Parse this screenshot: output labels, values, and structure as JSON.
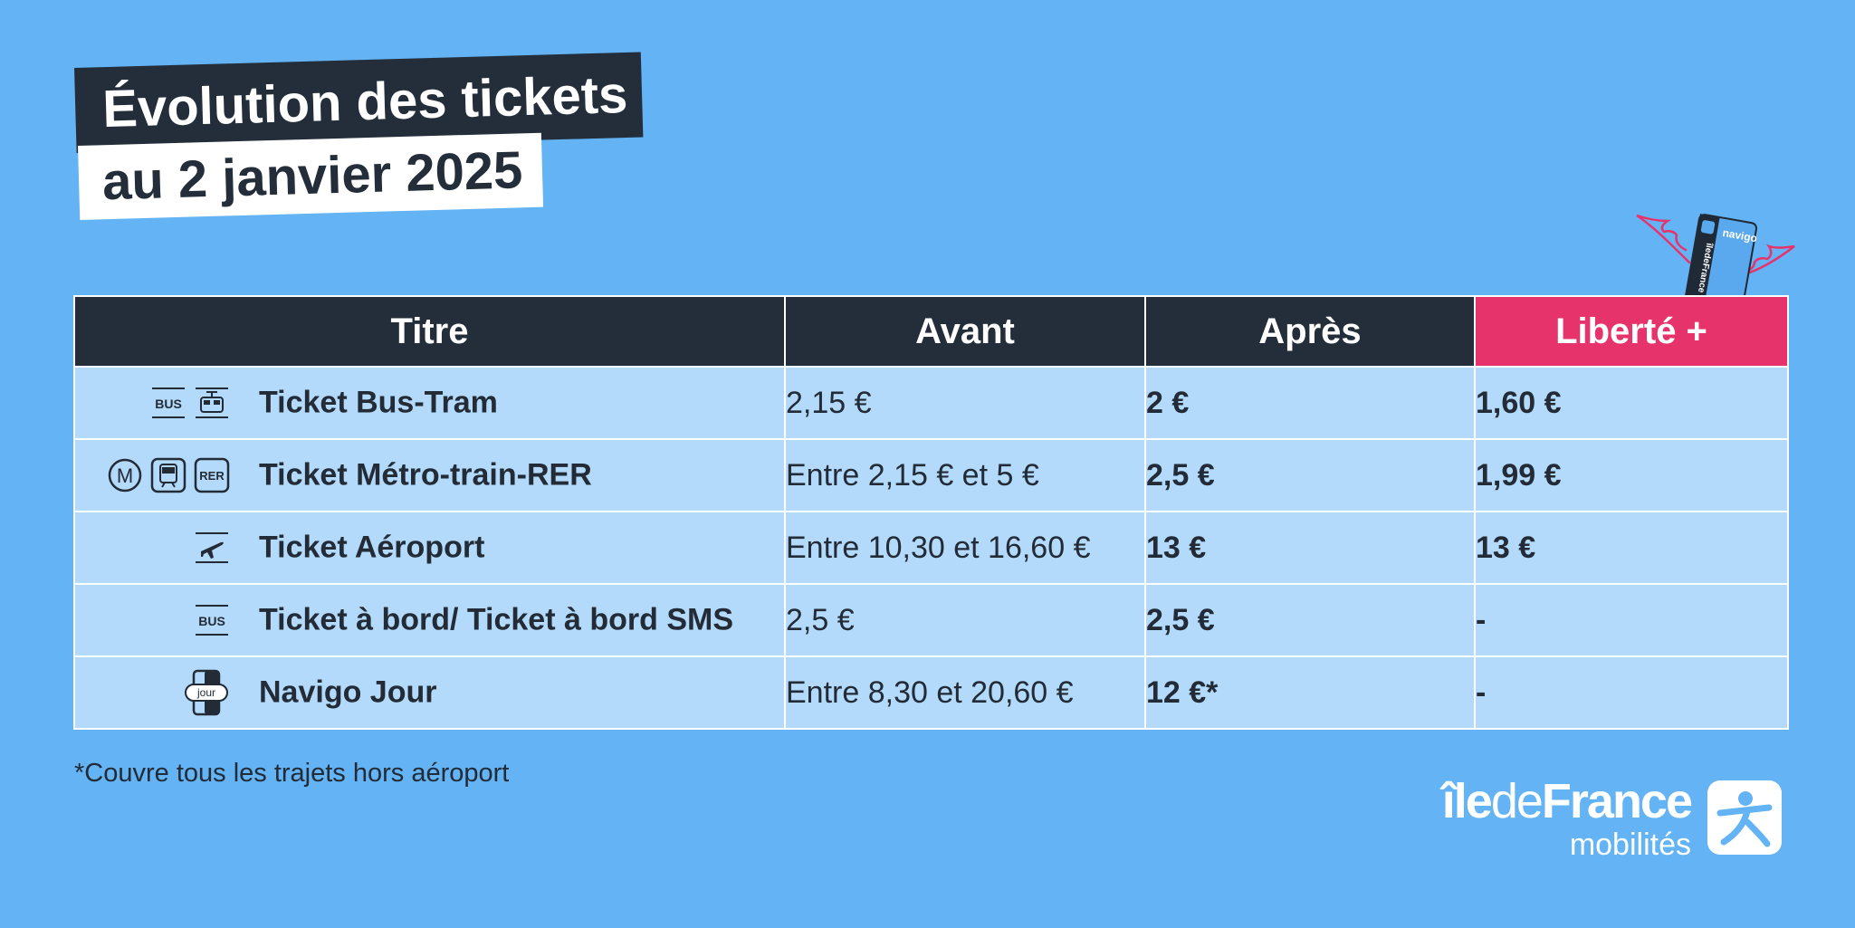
{
  "title": {
    "line1": "Évolution des tickets",
    "line2": "au 2 janvier 2025"
  },
  "table": {
    "headers": [
      "Titre",
      "Avant",
      "Après",
      "Liberté +"
    ],
    "rows": [
      {
        "icons": [
          "bus-icon",
          "tram-icon"
        ],
        "titre": "Ticket Bus-Tram",
        "avant": "2,15 €",
        "apres": "2 €",
        "liberte": "1,60 €"
      },
      {
        "icons": [
          "metro-icon",
          "train-icon",
          "rer-icon"
        ],
        "titre": "Ticket Métro-train-RER",
        "avant": "Entre 2,15 € et 5 €",
        "apres": "2,5 €",
        "liberte": "1,99 €"
      },
      {
        "icons": [
          "airplane-icon"
        ],
        "titre": "Ticket Aéroport",
        "avant": "Entre 10,30 et 16,60 €",
        "apres": "13 €",
        "liberte": "13 €"
      },
      {
        "icons": [
          "bus-icon"
        ],
        "titre": "Ticket à bord/ Ticket à bord SMS",
        "avant": "2,5 €",
        "apres": "2,5 €",
        "liberte": "-"
      },
      {
        "icons": [
          "navigo-jour-icon"
        ],
        "titre": "Navigo Jour",
        "avant": "Entre 8,30 et 20,60 €",
        "apres": "12 €*",
        "liberte": "-"
      }
    ]
  },
  "icon_labels": {
    "bus": "BUS",
    "rer": "RER",
    "metro": "M",
    "jour": "jour"
  },
  "footnote": "*Couvre tous les trajets hors aéroport",
  "logo": {
    "main_ile": "île",
    "main_de": "de",
    "main_france": "France",
    "sub": "mobilités",
    "card_label": "navigo",
    "card_brand": "îledeFrance"
  },
  "colors": {
    "background": "#63b3f5",
    "header": "#232e3a",
    "accent": "#e7336b",
    "row": "#b3dafb"
  }
}
